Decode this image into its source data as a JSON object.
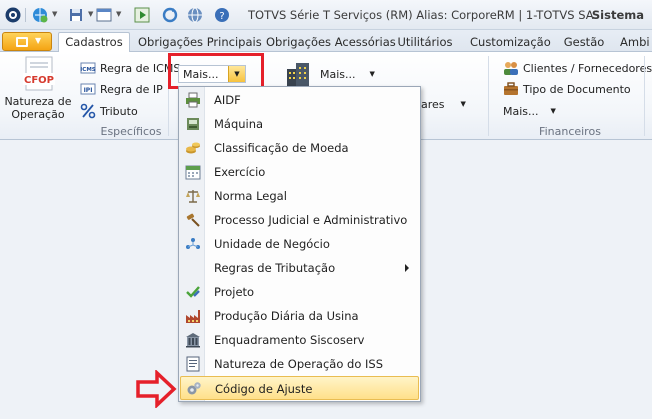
{
  "window": {
    "title": "TOTVS Série T Serviços (RM) Alias: CorporeRM | 1-TOTVS SA",
    "user_area": "Sistema"
  },
  "tabs": [
    {
      "label": "Cadastros",
      "active": true
    },
    {
      "label": "Obrigações Principais"
    },
    {
      "label": "Obrigações Acessórias"
    },
    {
      "label": "Utilitários"
    },
    {
      "label": "Customização"
    },
    {
      "label": "Gestão"
    },
    {
      "label": "Ambi"
    }
  ],
  "ribbon": {
    "natureza": {
      "icon_text": "CFOP",
      "label_line1": "Natureza de",
      "label_line2": "Operação"
    },
    "especificos": {
      "label": "Específicos",
      "regra_icms": "Regra de ICMS",
      "regra_ipi": "Regra de IP",
      "tributo": "Tributo",
      "icms_icon_text": "ICMS",
      "ipi_icon_text": "IPI",
      "combo_value": "Mais..."
    },
    "middle": {
      "mais_label": "Mais...",
      "partial_label": "ares"
    },
    "financeiros": {
      "label": "Financeiros",
      "clientes": "Clientes / Fornecedores",
      "tipo_documento": "Tipo de Documento",
      "mais": "Mais..."
    }
  },
  "menu": {
    "items": [
      {
        "label": "AIDF",
        "icon": "printer-icon"
      },
      {
        "label": "Máquina",
        "icon": "machine-icon"
      },
      {
        "label": "Classificação de Moeda",
        "icon": "coins-icon"
      },
      {
        "label": "Exercício",
        "icon": "calendar-icon"
      },
      {
        "label": "Norma Legal",
        "icon": "scales-icon"
      },
      {
        "label": "Processo Judicial e Administrativo",
        "icon": "gavel-icon"
      },
      {
        "label": "Unidade de Negócio",
        "icon": "people-network-icon"
      },
      {
        "label": "Regras de Tributação",
        "icon": "none",
        "submenu": true
      },
      {
        "label": "Projeto",
        "icon": "check-pencil-icon"
      },
      {
        "label": "Produção Diária da Usina",
        "icon": "factory-icon"
      },
      {
        "label": "Enquadramento Siscoserv",
        "icon": "building-icon"
      },
      {
        "label": "Natureza de Operação do ISS",
        "icon": "document-icon"
      },
      {
        "label": "Código de Ajuste",
        "icon": "gears-icon",
        "highlighted": true
      }
    ]
  },
  "colors": {
    "accent_orange": "#f4a414",
    "highlight_red": "#e5202a",
    "menu_highlight": "#ffe08a"
  }
}
